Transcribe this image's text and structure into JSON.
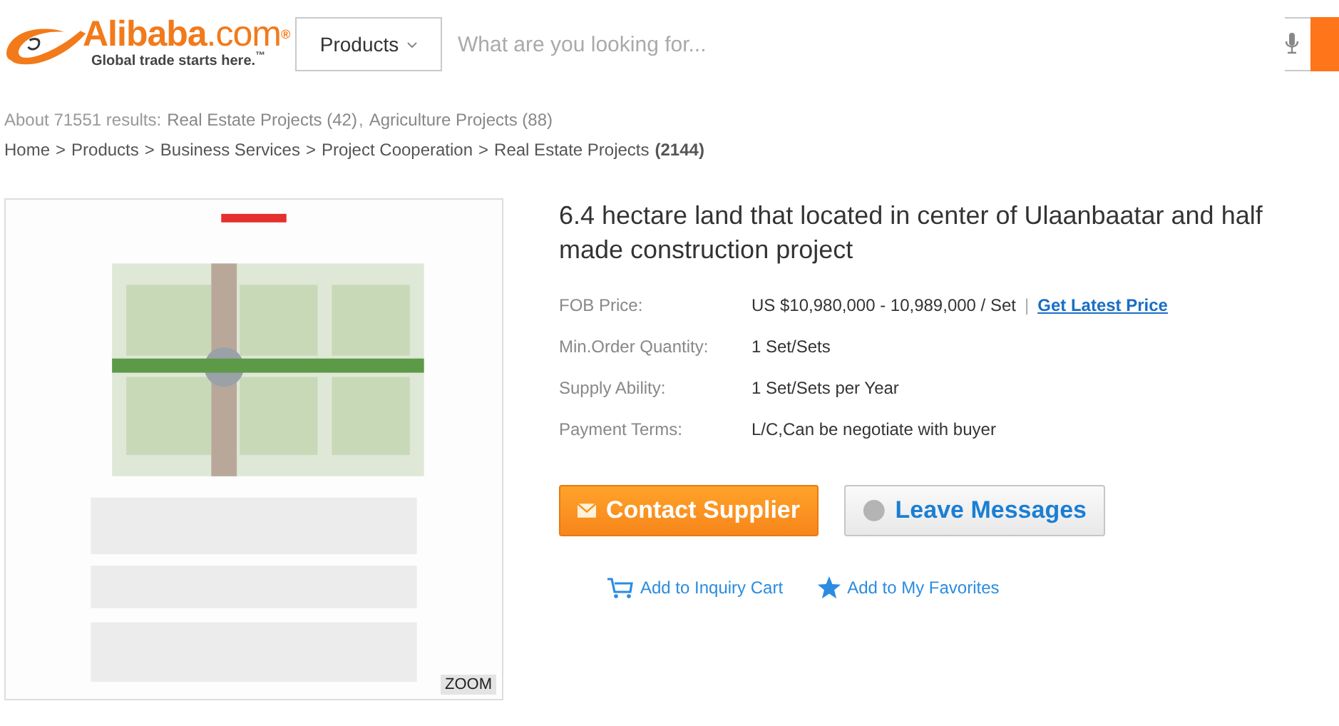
{
  "header": {
    "logo": {
      "brand": "Alibaba",
      "suffix": ".com",
      "mark": "®",
      "tagline": "Global trade starts here.",
      "tagline_mark": "™"
    },
    "search": {
      "category": "Products",
      "placeholder": "What are you looking for..."
    }
  },
  "results": {
    "summary": "About 71551 results:",
    "separator": ",",
    "categories": [
      {
        "label": "Real Estate Projects (42)"
      },
      {
        "label": "Agriculture Projects (88)"
      }
    ]
  },
  "breadcrumb_separator": ">",
  "breadcrumb": [
    {
      "label": "Home"
    },
    {
      "label": "Products"
    },
    {
      "label": "Business Services"
    },
    {
      "label": "Project Cooperation"
    },
    {
      "label": "Real Estate Projects",
      "count": "(2144)"
    }
  ],
  "gallery": {
    "kind": "picture",
    "zoom": "ZOOM"
  },
  "product": {
    "title": "6.4 hectare land that located in center of Ulaanbaatar and half made construction project",
    "specs": [
      {
        "label": "FOB Price:",
        "value": "US $10,980,000 - 10,989,000 / Set",
        "divider": "|",
        "link": "Get Latest Price"
      },
      {
        "label": "Min.Order Quantity:",
        "value": "1 Set/Sets"
      },
      {
        "label": "Supply Ability:",
        "value": "1 Set/Sets per Year"
      },
      {
        "label": "Payment Terms:",
        "value": "L/C,Can be negotiate with buyer"
      }
    ],
    "buttons": [
      {
        "kind": "primary",
        "label": "Contact Supplier"
      },
      {
        "kind": "secondary",
        "label": "Leave Messages"
      }
    ],
    "links": [
      {
        "kind": "cart",
        "label": "Add to Inquiry Cart"
      },
      {
        "kind": "favorite",
        "label": "Add to My Favorites"
      }
    ]
  }
}
